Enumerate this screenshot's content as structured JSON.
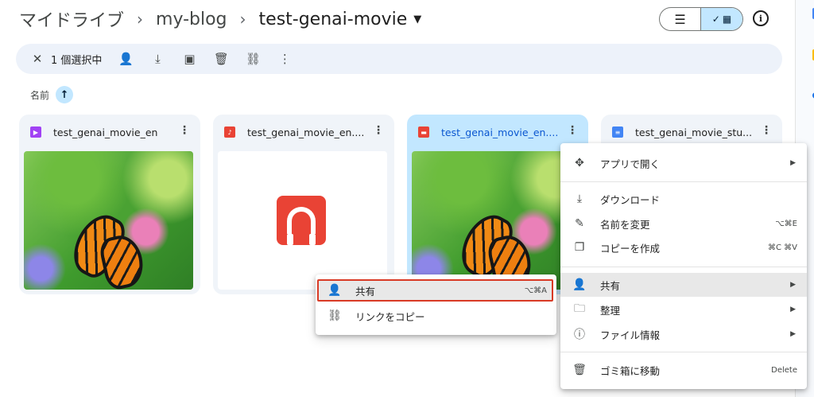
{
  "breadcrumb": {
    "root": "マイドライブ",
    "folder": "my-blog",
    "current": "test-genai-movie"
  },
  "selection_bar": {
    "count_label": "1 個選択中"
  },
  "sort": {
    "label": "名前"
  },
  "files": [
    {
      "name": "test_genai_movie_en",
      "type": "video",
      "icon_color": "#a142f4"
    },
    {
      "name": "test_genai_movie_en....",
      "type": "audio",
      "icon_color": "#e94335"
    },
    {
      "name": "test_genai_movie_en....",
      "type": "video-file",
      "icon_color": "#e94335"
    },
    {
      "name": "test_genai_movie_stu...",
      "type": "document",
      "icon_color": "#4285f4"
    }
  ],
  "share_submenu": {
    "share": {
      "label": "共有",
      "shortcut": "⌥⌘A"
    },
    "copy_link": {
      "label": "リンクをコピー"
    }
  },
  "context_menu": {
    "open_with": "アプリで開く",
    "download": "ダウンロード",
    "rename": {
      "label": "名前を変更",
      "shortcut": "⌥⌘E"
    },
    "make_copy": {
      "label": "コピーを作成",
      "shortcut": "⌘C ⌘V"
    },
    "share": "共有",
    "organize": "整理",
    "file_info": "ファイル情報",
    "trash": {
      "label": "ゴミ箱に移動",
      "shortcut": "Delete"
    }
  },
  "colors": {
    "accent": "#c2e7ff",
    "highlight_border": "#d93b26",
    "bar_bg": "#edf2fa"
  }
}
